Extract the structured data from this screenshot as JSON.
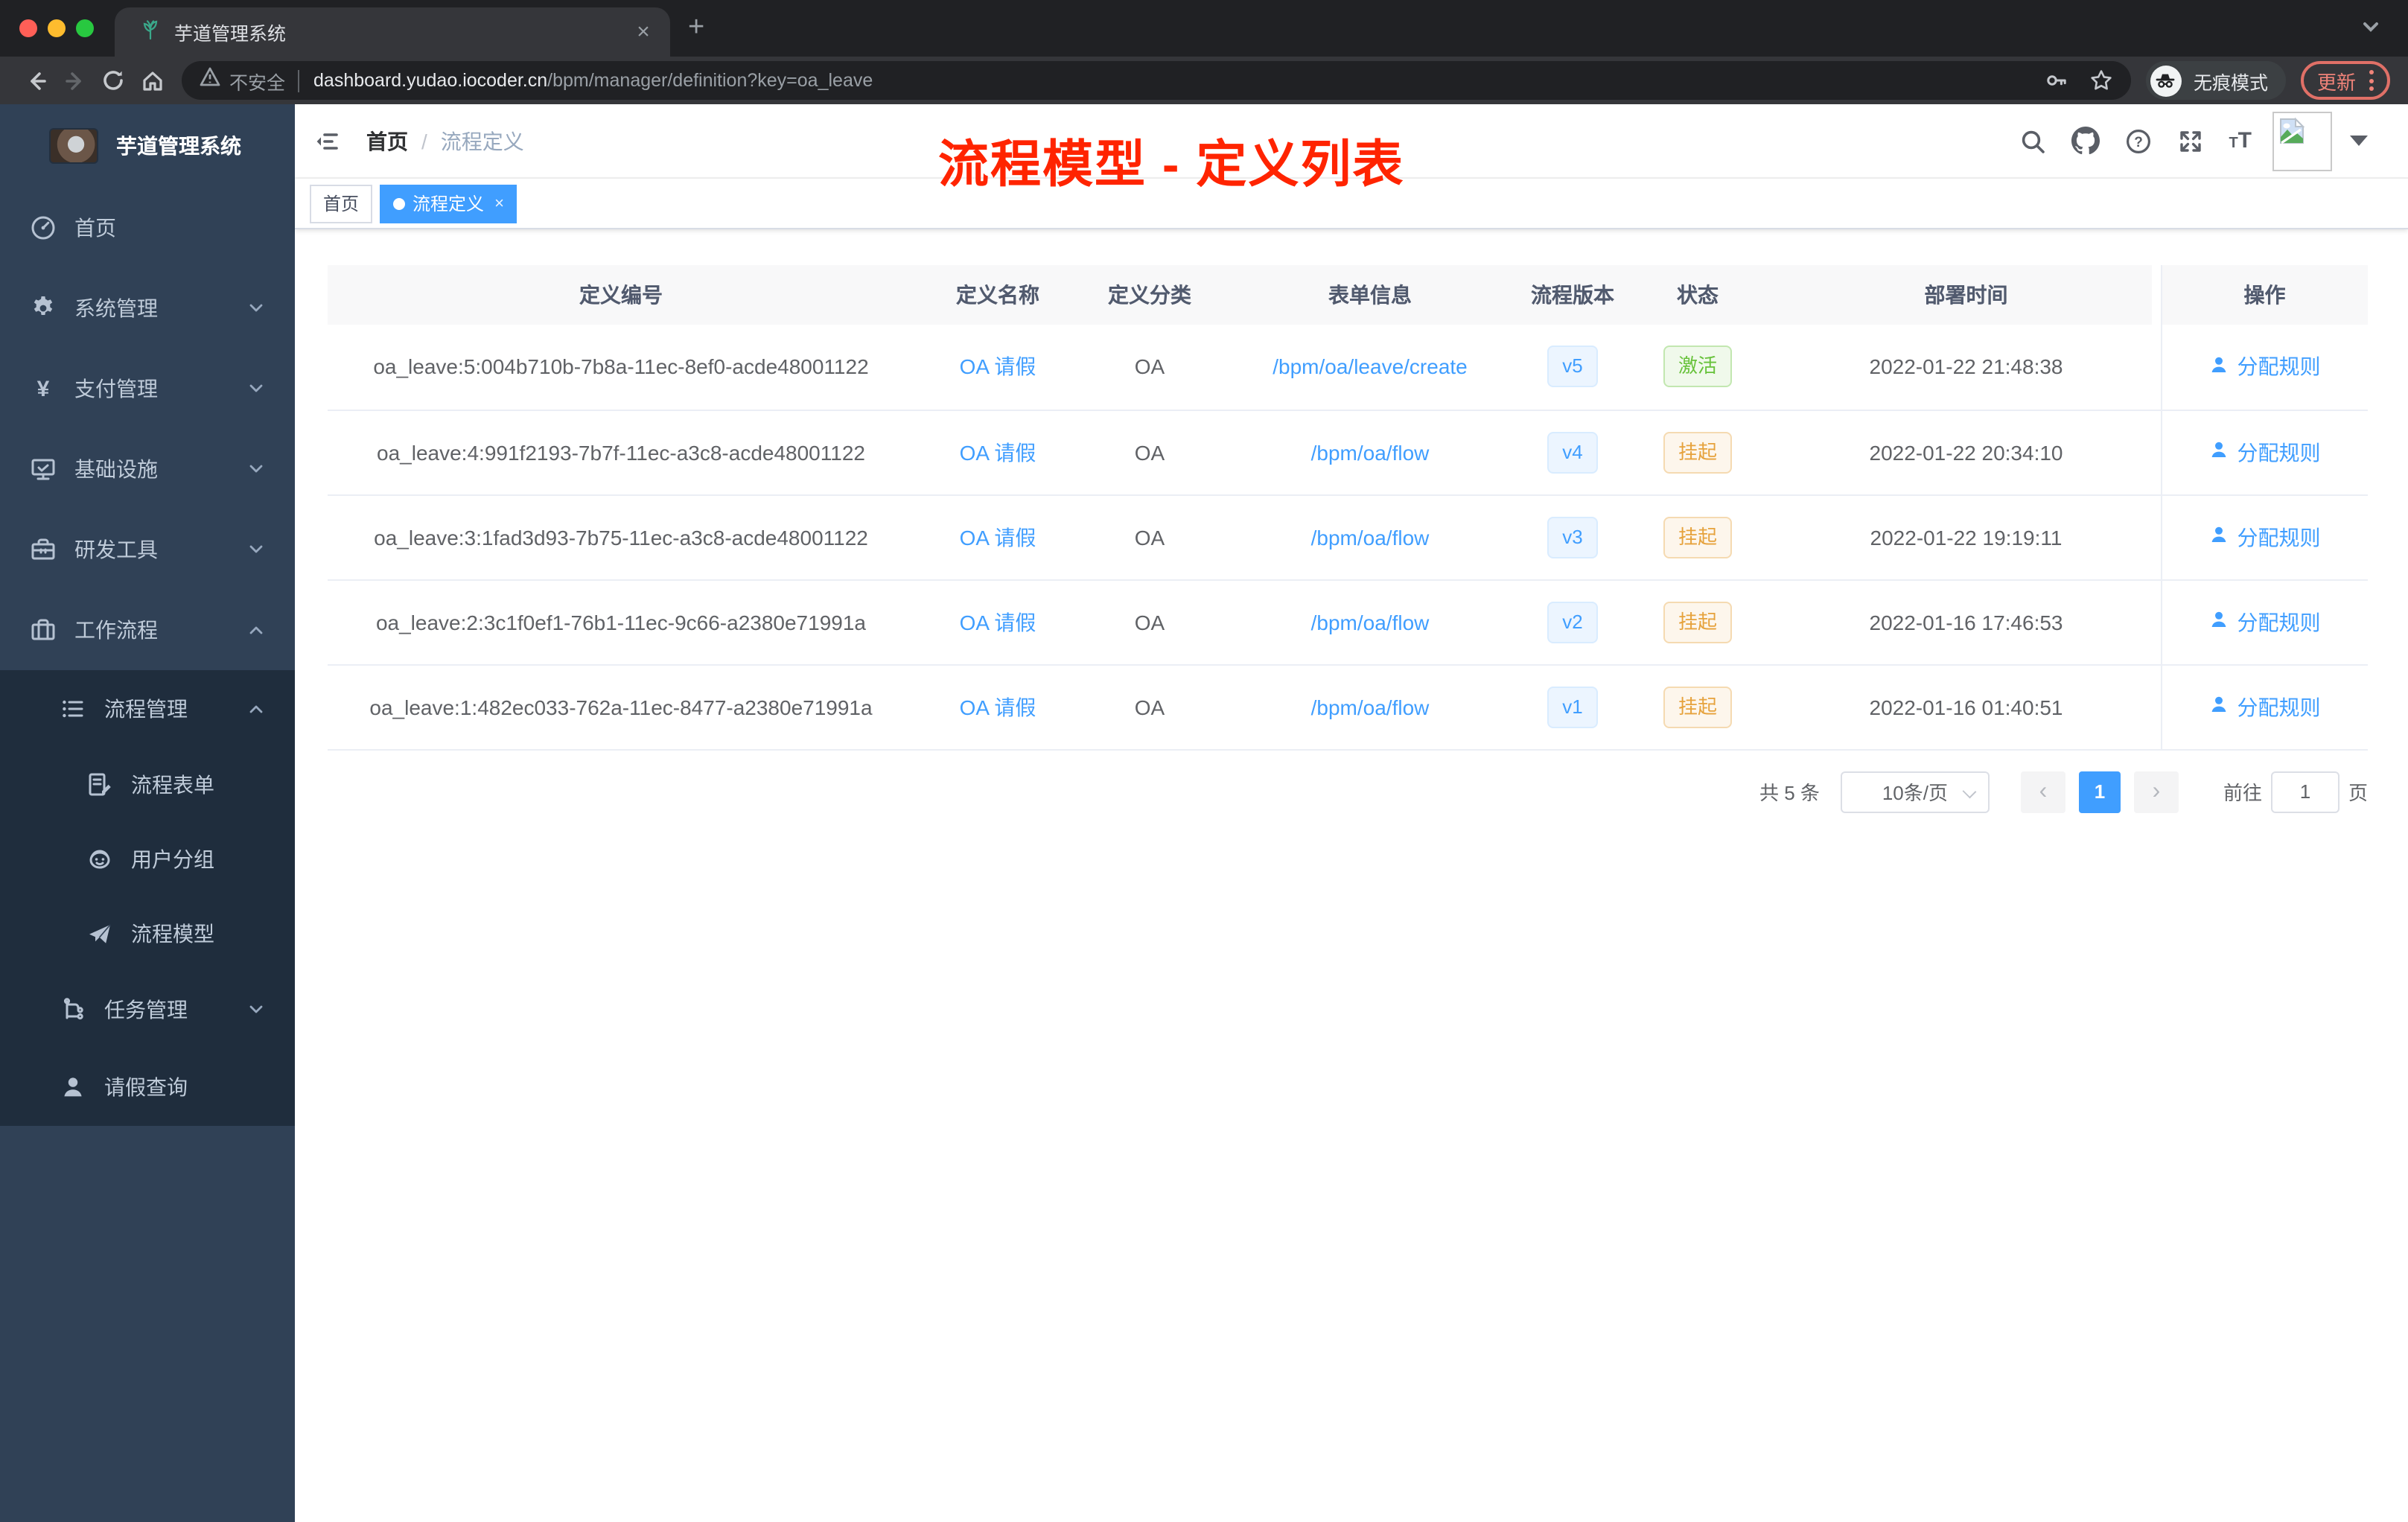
{
  "browser": {
    "tab_title": "芋道管理系统",
    "security_label": "不安全",
    "url_host": "dashboard.yudao.iocoder.cn",
    "url_path": "/bpm/manager/definition?key=oa_leave",
    "incognito_label": "无痕模式",
    "update_label": "更新"
  },
  "sidebar": {
    "logo_title": "芋道管理系统",
    "items": [
      {
        "label": "首页",
        "icon": "dashboard",
        "level": 0,
        "arrow": null,
        "dark": false
      },
      {
        "label": "系统管理",
        "icon": "gear",
        "level": 0,
        "arrow": "down",
        "dark": false
      },
      {
        "label": "支付管理",
        "icon": "yen",
        "level": 0,
        "arrow": "down",
        "dark": false
      },
      {
        "label": "基础设施",
        "icon": "monitor",
        "level": 0,
        "arrow": "down",
        "dark": false
      },
      {
        "label": "研发工具",
        "icon": "toolbox",
        "level": 0,
        "arrow": "down",
        "dark": false
      },
      {
        "label": "工作流程",
        "icon": "suitcase",
        "level": 0,
        "arrow": "up",
        "dark": false
      },
      {
        "label": "流程管理",
        "icon": "list",
        "level": 1,
        "arrow": "up",
        "dark": true
      },
      {
        "label": "流程表单",
        "icon": "form",
        "level": 2,
        "arrow": null,
        "dark": true
      },
      {
        "label": "用户分组",
        "icon": "people",
        "level": 2,
        "arrow": null,
        "dark": true
      },
      {
        "label": "流程模型",
        "icon": "send",
        "level": 2,
        "arrow": null,
        "dark": true
      },
      {
        "label": "任务管理",
        "icon": "tree",
        "level": 1,
        "arrow": "down",
        "dark": true
      },
      {
        "label": "请假查询",
        "icon": "user",
        "level": 1,
        "arrow": null,
        "dark": true
      }
    ]
  },
  "navbar": {
    "breadcrumb": [
      "首页",
      "流程定义"
    ],
    "right_icons": [
      "search-icon",
      "github-icon",
      "help-icon",
      "fullscreen-icon",
      "font-size-icon",
      "avatar",
      "dropdown-caret"
    ]
  },
  "tags": [
    {
      "label": "首页",
      "active": false
    },
    {
      "label": "流程定义",
      "active": true,
      "close": "×"
    }
  ],
  "annotation": {
    "text": "流程模型 - 定义列表",
    "color": "#ff2400"
  },
  "table": {
    "headers": [
      "定义编号",
      "定义名称",
      "定义分类",
      "表单信息",
      "流程版本",
      "状态",
      "部署时间",
      "操作"
    ],
    "action_label": "分配规则",
    "rows": [
      {
        "id": "oa_leave:5:004b710b-7b8a-11ec-8ef0-acde48001122",
        "name": "OA 请假",
        "category": "OA",
        "form": "/bpm/oa/leave/create",
        "version": "v5",
        "status": "激活",
        "status_type": "success",
        "time": "2022-01-22 21:48:38"
      },
      {
        "id": "oa_leave:4:991f2193-7b7f-11ec-a3c8-acde48001122",
        "name": "OA 请假",
        "category": "OA",
        "form": "/bpm/oa/flow",
        "version": "v4",
        "status": "挂起",
        "status_type": "warning",
        "time": "2022-01-22 20:34:10"
      },
      {
        "id": "oa_leave:3:1fad3d93-7b75-11ec-a3c8-acde48001122",
        "name": "OA 请假",
        "category": "OA",
        "form": "/bpm/oa/flow",
        "version": "v3",
        "status": "挂起",
        "status_type": "warning",
        "time": "2022-01-22 19:19:11"
      },
      {
        "id": "oa_leave:2:3c1f0ef1-76b1-11ec-9c66-a2380e71991a",
        "name": "OA 请假",
        "category": "OA",
        "form": "/bpm/oa/flow",
        "version": "v2",
        "status": "挂起",
        "status_type": "warning",
        "time": "2022-01-16 17:46:53"
      },
      {
        "id": "oa_leave:1:482ec033-762a-11ec-8477-a2380e71991a",
        "name": "OA 请假",
        "category": "OA",
        "form": "/bpm/oa/flow",
        "version": "v1",
        "status": "挂起",
        "status_type": "warning",
        "time": "2022-01-16 01:40:51"
      }
    ]
  },
  "pagination": {
    "total_label": "共 5 条",
    "page_size": "10条/页",
    "current_page": "1",
    "goto_label": "前往",
    "goto_value": "1",
    "page_suffix": "页"
  },
  "colors": {
    "accent": "#409eff",
    "sidebar_bg": "#304156",
    "sidebar_submenu_bg": "#1f2d3d",
    "annotation_red": "#ff2400",
    "version_badge": {
      "bg": "#ecf5ff",
      "border": "#d9ecff",
      "text": "#409eff"
    },
    "status_active": {
      "bg": "#f0f9eb",
      "border": "#c2e7b0",
      "text": "#67c23a"
    },
    "status_suspended": {
      "bg": "#fdf6ec",
      "border": "#f5dab1",
      "text": "#e6a23c"
    }
  }
}
